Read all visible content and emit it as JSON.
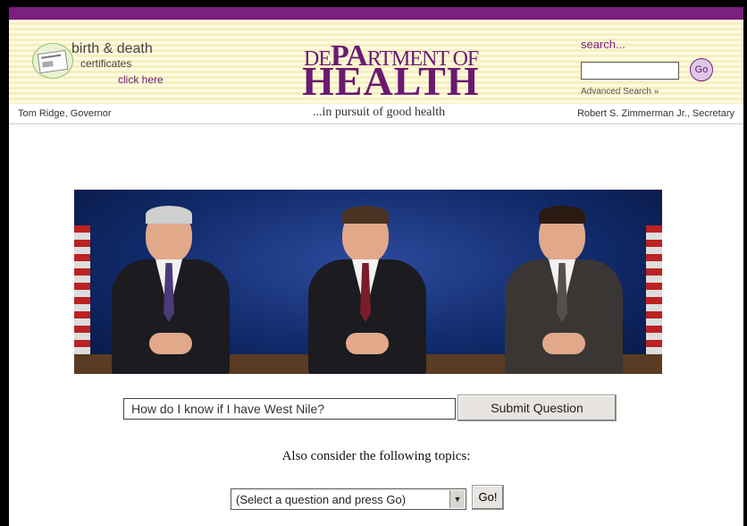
{
  "header": {
    "cert_title": "birth & death",
    "cert_sub": "certificates",
    "cert_link": "click here",
    "logo_top_prefix": "DE",
    "logo_top_big": "PA",
    "logo_top_suffix": "RTMENT OF",
    "logo_main": "HEALTH",
    "search_label": "search...",
    "search_value": "",
    "go_label": "Go",
    "advanced_search": "Advanced Search »"
  },
  "infobar": {
    "governor": "Tom Ridge, Governor",
    "tagline": "...in pursuit of good health",
    "secretary": "Robert S. Zimmerman Jr., Secretary"
  },
  "qa": {
    "question_value": "How do I know if I have West Nile?",
    "submit_label": "Submit Question",
    "also_text": "Also consider the following topics:",
    "select_value": "(Select a question and press Go)",
    "go_label": "Go!"
  },
  "colors": {
    "brand_purple": "#6a1a70",
    "banner_stripe": "#f6efbf"
  }
}
